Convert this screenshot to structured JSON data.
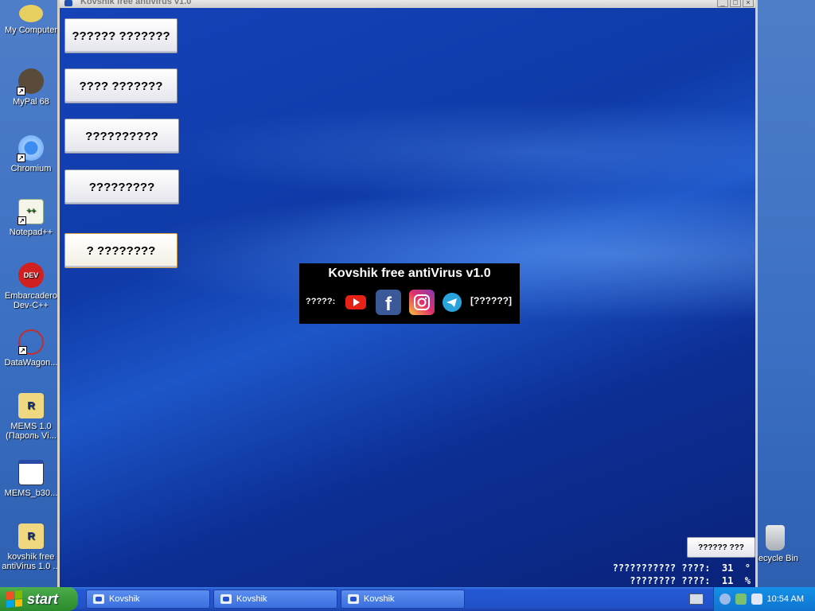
{
  "desktop": {
    "icons": [
      {
        "label": "My Computer"
      },
      {
        "label": "MyPal 68"
      },
      {
        "label": "Chromium"
      },
      {
        "label": "Notepad++"
      },
      {
        "label": "Embarcadero Dev-C++"
      },
      {
        "label": "DataWagon..."
      },
      {
        "label": "MEMS 1.0 (Пароль Vi..."
      },
      {
        "label": "MEMS_b30..."
      },
      {
        "label": "kovshik free antiVirus 1.0 ..."
      },
      {
        "label": "Recycle Bin"
      }
    ]
  },
  "app": {
    "title": "Kovshik free antivirus v1.0",
    "menu": [
      {
        "label": "?????? ???????"
      },
      {
        "label": "???? ???????"
      },
      {
        "label": "??????????"
      },
      {
        "label": "?????????"
      },
      {
        "label": "? ????????"
      }
    ],
    "banner": {
      "title": "Kovshik free antiVirus v1.0",
      "contacts_label": "?????:",
      "contacts_link": "[??????]",
      "socials": [
        "youtube-icon",
        "facebook-icon",
        "instagram-icon",
        "telegram-icon"
      ]
    },
    "hw_button": "?????? ???",
    "stats": {
      "temp": "??????????? ????:  31  °",
      "load": "???????? ????:  11  %"
    }
  },
  "taskbar": {
    "start_label": "start",
    "tasks": [
      {
        "label": "Kovshik"
      },
      {
        "label": "Kovshik"
      },
      {
        "label": "Kovshik"
      }
    ],
    "clock": "10:54 AM"
  }
}
